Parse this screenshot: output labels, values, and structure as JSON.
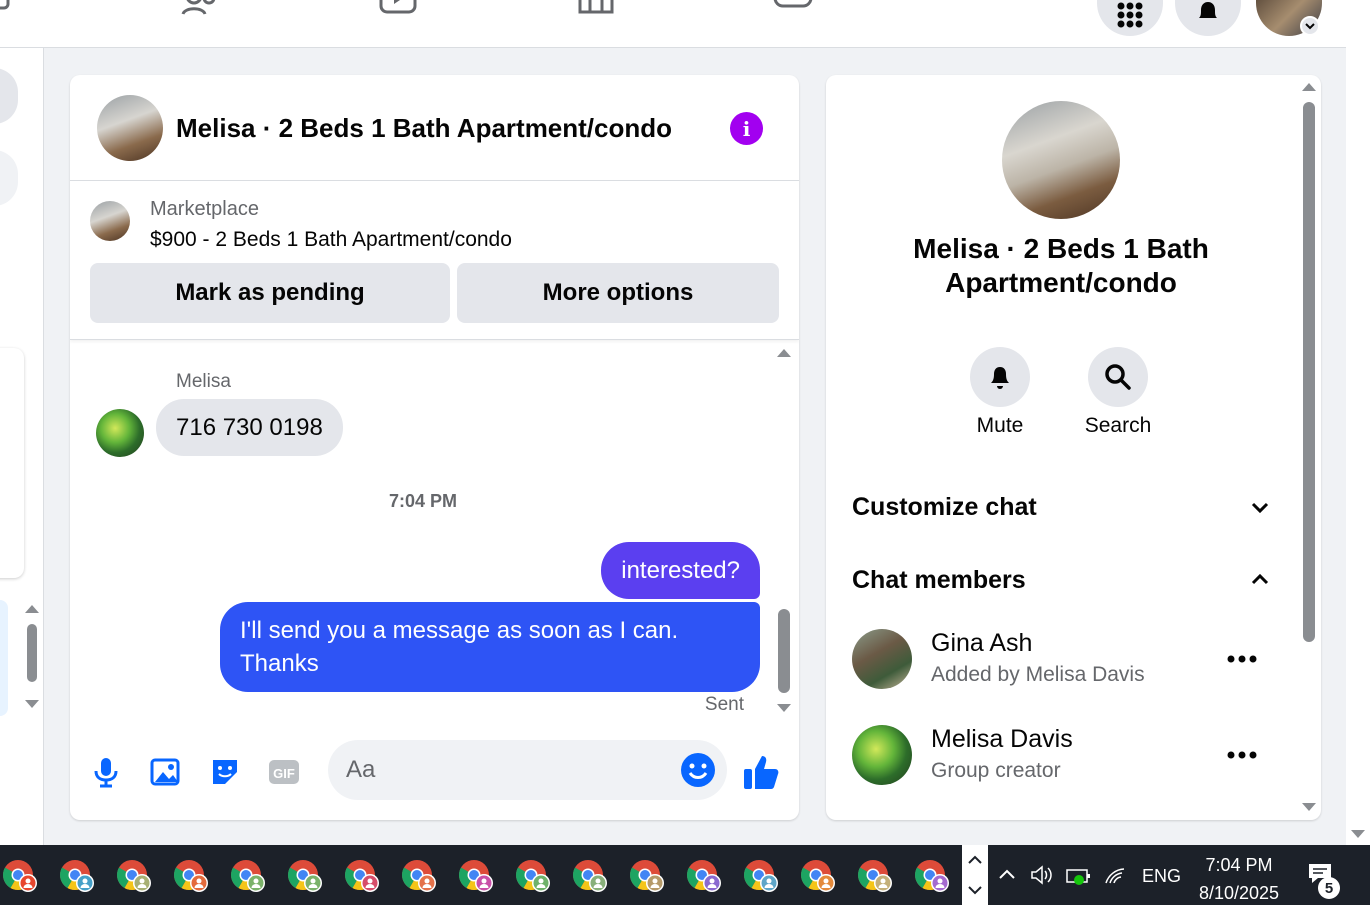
{
  "top_nav": {
    "icons": [
      "pages-icon",
      "groups-icon",
      "video-icon",
      "marketplace-icon",
      "gaming-icon"
    ],
    "right_buttons": [
      "menu-grid-icon",
      "notifications-bell-icon"
    ],
    "profile": "profile-avatar"
  },
  "chat": {
    "title": "Melisa · 2 Beds 1 Bath Apartment/condo",
    "listing": {
      "source": "Marketplace",
      "price_title": "$900 - 2 Beds 1 Bath Apartment/condo",
      "mark_pending_label": "Mark as pending",
      "more_options_label": "More options"
    },
    "messages": {
      "sender_name": "Melisa",
      "incoming_text": "716 730 0198",
      "timestamp": "7:04 PM",
      "outgoing_1": "interested?",
      "outgoing_2": "I'll send you a message as soon as I can. Thanks",
      "status": "Sent"
    },
    "composer": {
      "placeholder": "Aa",
      "icons": [
        "microphone-icon",
        "photo-icon",
        "sticker-icon",
        "gif-icon",
        "emoji-icon",
        "thumbs-up-icon"
      ]
    }
  },
  "info_panel": {
    "title": "Melisa · 2 Beds 1 Bath Apartment/condo",
    "actions": [
      {
        "label": "Mute",
        "icon": "bell-icon"
      },
      {
        "label": "Search",
        "icon": "search-icon"
      }
    ],
    "sections": {
      "customize": "Customize chat",
      "members": "Chat members"
    },
    "members": [
      {
        "name": "Gina Ash",
        "subtitle": "Added by Melisa Davis"
      },
      {
        "name": "Melisa Davis",
        "subtitle": "Group creator"
      }
    ]
  },
  "taskbar": {
    "app_count": 17,
    "tray": {
      "language": "ENG",
      "time": "7:04 PM",
      "date": "8/10/2025",
      "notification_count": "5"
    }
  },
  "colors": {
    "messenger_blue": "#0866ff",
    "outgoing_purple": "#5b3ff0",
    "outgoing_blue": "#2e54f5",
    "info_purple": "#a200f0",
    "taskbar": "#1c2129"
  }
}
